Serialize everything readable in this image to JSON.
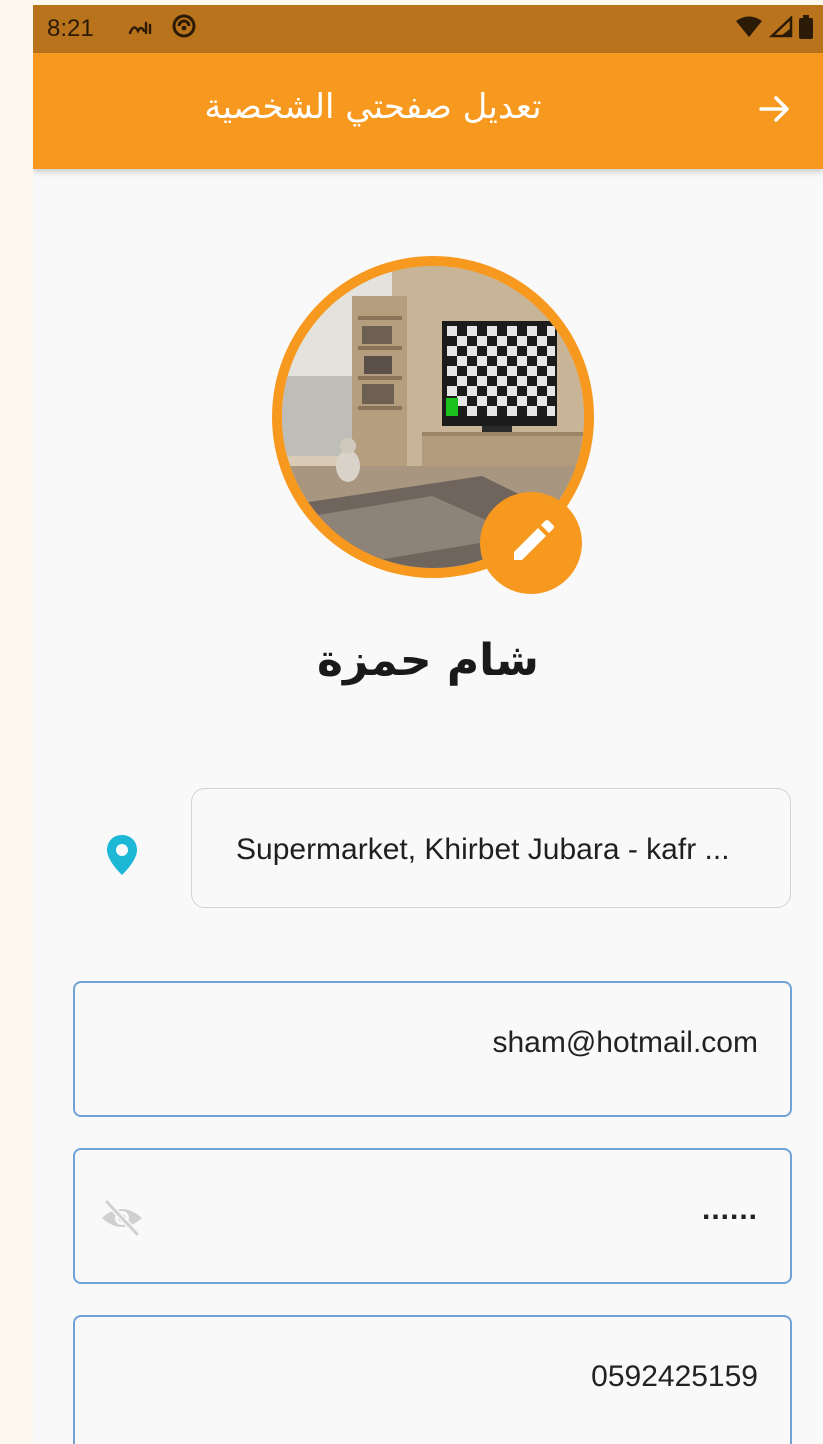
{
  "status_bar": {
    "time": "8:21"
  },
  "app_bar": {
    "title": "تعديل صفحتي الشخصية",
    "back_icon": "arrow-right-icon"
  },
  "profile": {
    "name": "شام حمزة",
    "avatar_image": "room-photo",
    "edit_icon": "pencil-icon"
  },
  "form": {
    "address": {
      "icon": "location-pin-icon",
      "value": "Supermarket,  Khirbet Jubara - kafr ..."
    },
    "email": {
      "value": "sham@hotmail.com"
    },
    "password": {
      "value": "......",
      "toggle_icon": "eye-off-icon"
    },
    "phone": {
      "value": "0592425159"
    }
  },
  "colors": {
    "primary": "#f7981f",
    "status_bar": "#b8731c",
    "location_icon": "#1cb8d6",
    "input_border": "#6fa3d8"
  }
}
